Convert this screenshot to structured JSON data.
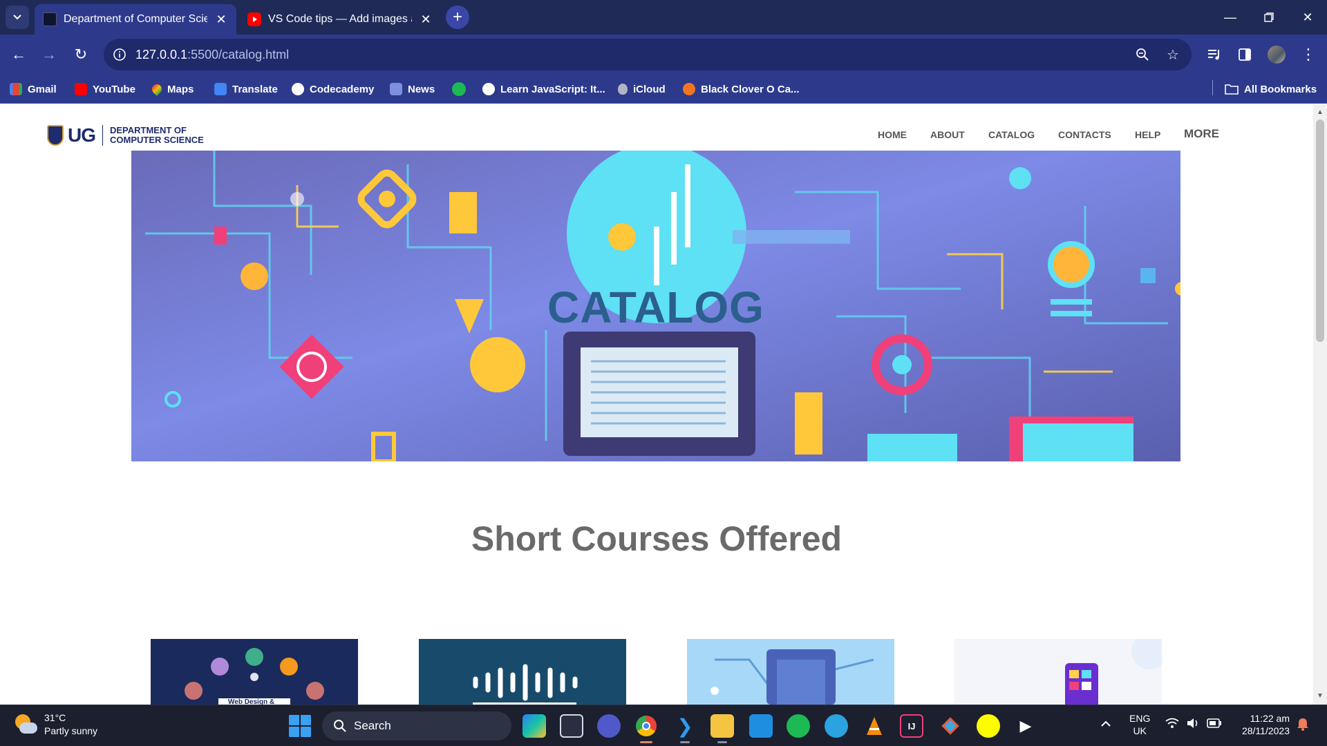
{
  "browser": {
    "tabs": [
      {
        "title": "Department of Computer Scien",
        "active": true
      },
      {
        "title": "VS Code tips — Add images an",
        "active": false
      }
    ],
    "url_host": "127.0.0.1",
    "url_path": ":5500/catalog.html",
    "bookmarks": [
      {
        "label": "Gmail",
        "icon": "gmail-icon"
      },
      {
        "label": "YouTube",
        "icon": "youtube-icon"
      },
      {
        "label": "Maps",
        "icon": "maps-icon"
      },
      {
        "label": "Translate",
        "icon": "translate-icon"
      },
      {
        "label": "Codecademy",
        "icon": "codecademy-icon"
      },
      {
        "label": "News",
        "icon": "news-icon"
      },
      {
        "label": "",
        "icon": "spotify-icon"
      },
      {
        "label": "Learn JavaScript: It...",
        "icon": "globe-icon"
      },
      {
        "label": "iCloud",
        "icon": "apple-icon"
      },
      {
        "label": "Black Clover O Ca...",
        "icon": "crunchyroll-icon"
      }
    ],
    "all_bookmarks_label": "All Bookmarks"
  },
  "site": {
    "logo_ug": "UG",
    "logo_dept_line1": "DEPARTMENT OF",
    "logo_dept_line2": "COMPUTER SCIENCE",
    "nav": [
      "HOME",
      "ABOUT",
      "CATALOG",
      "CONTACTS",
      "HELP",
      "MORE"
    ],
    "hero_title": "CATALOG",
    "section_title": "Short Courses Offered",
    "course_card_caption": "Web Design &"
  },
  "taskbar": {
    "weather_temp": "31°C",
    "weather_desc": "Partly sunny",
    "search_label": "Search",
    "lang_line1": "ENG",
    "lang_line2": "UK",
    "time": "11:22 am",
    "date": "28/11/2023"
  },
  "colors": {
    "chrome_dark": "#1f2a57",
    "chrome": "#2d3a8c",
    "hero_bg": "#6f7fd8",
    "hero_title": "#2b5f8e",
    "section_title": "#6a6a6a",
    "taskbar": "#1c1f2e"
  }
}
